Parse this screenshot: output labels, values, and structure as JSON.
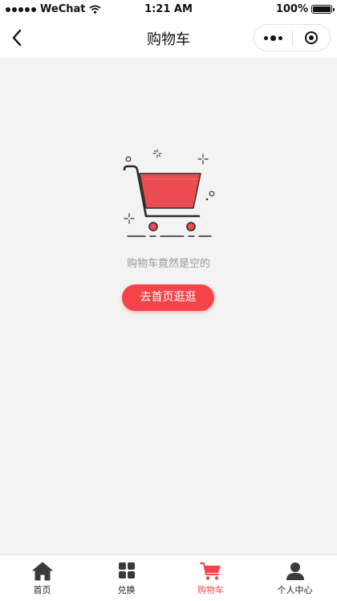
{
  "status_bar": {
    "carrier": "WeChat",
    "time": "1:21 AM",
    "battery": "100%"
  },
  "nav": {
    "title": "购物车",
    "back_icon": "chevron-left-icon",
    "menu_icon": "more-dots-icon",
    "close_icon": "target-circle-icon"
  },
  "empty_state": {
    "illustration_icon": "empty-cart-icon",
    "message": "购物车竟然是空的",
    "button_label": "去首页逛逛"
  },
  "tab_bar": {
    "active_color": "#f4444a",
    "items": [
      {
        "label": "首页",
        "icon": "home-icon"
      },
      {
        "label": "兑换",
        "icon": "grid-icon"
      },
      {
        "label": "购物车",
        "icon": "cart-icon"
      },
      {
        "label": "个人中心",
        "icon": "user-icon"
      }
    ]
  },
  "colors": {
    "accent": "#f4444a",
    "background": "#f3f3f3"
  }
}
